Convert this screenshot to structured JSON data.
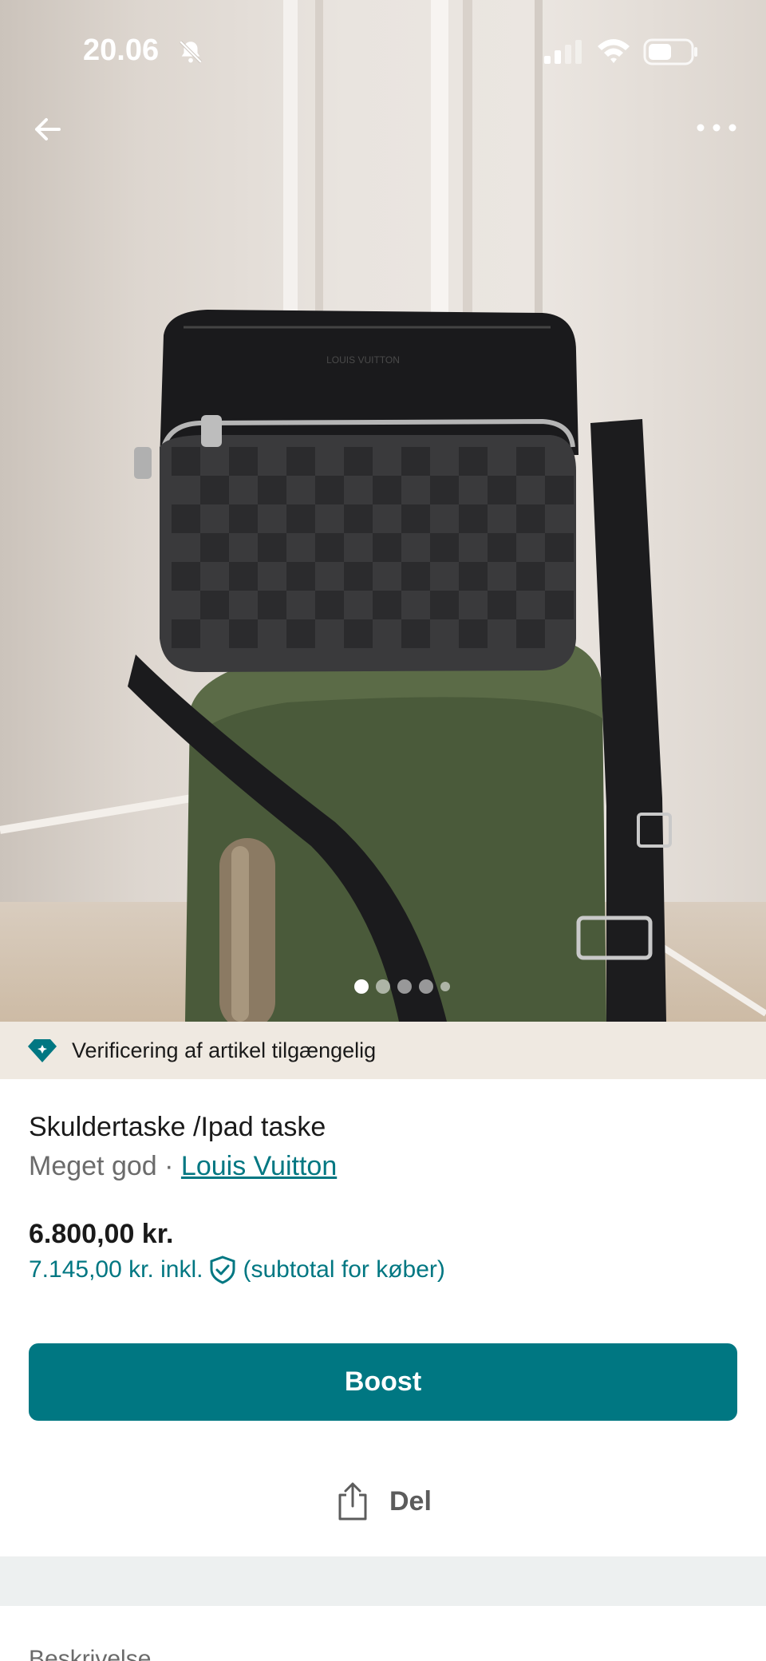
{
  "status_bar": {
    "time": "20.06",
    "icons": [
      "bell-off-icon",
      "cellular-signal-icon",
      "wifi-icon",
      "battery-icon"
    ]
  },
  "header": {
    "back_icon": "arrow-left-icon",
    "more_icon": "more-horizontal-icon"
  },
  "gallery": {
    "image_description": "black checkered crossbody bag on green boucle stool",
    "image_count": 5,
    "active_index": 0
  },
  "verification": {
    "icon": "diamond-badge-icon",
    "text": "Verificering af artikel tilgængelig",
    "background": "#efe9e1",
    "icon_color": "#007782"
  },
  "item": {
    "title": "Skuldertaske /Ipad taske",
    "condition": "Meget god",
    "separator": "·",
    "brand": "Louis Vuitton",
    "price": "6.800,00 kr.",
    "price_incl": "7.145,00 kr. inkl.",
    "price_incl_suffix": "(subtotal for køber)",
    "protection_icon": "shield-check-icon"
  },
  "actions": {
    "boost_label": "Boost",
    "share_label": "Del",
    "share_icon": "share-icon",
    "accent": "#007782"
  },
  "next_section": {
    "label": "Beskrivelse"
  }
}
